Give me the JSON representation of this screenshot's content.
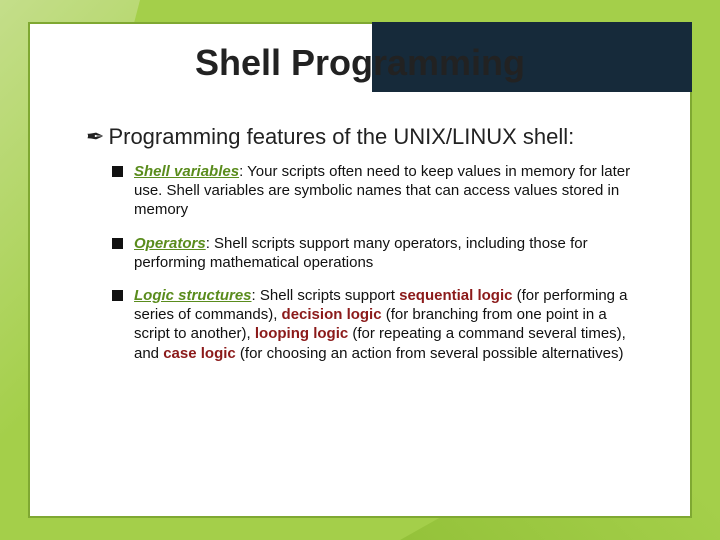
{
  "title": "Shell Programming",
  "intro_bullet": "✒",
  "intro": "Programming features of the UNIX/LINUX shell:",
  "items": [
    {
      "term": "Shell variables",
      "sep": ":  ",
      "rest": "Your scripts often need to keep values in memory for later use.  Shell variables are symbolic names that can access values stored in memory"
    },
    {
      "term": "Operators",
      "sep": ":  ",
      "rest": "Shell scripts support many operators, including those for performing mathematical operations"
    },
    {
      "term": "Logic structures",
      "sep": ":  ",
      "rest_prefix": "Shell scripts support ",
      "e1": "sequential logic",
      "p1": " (for performing a series of commands), ",
      "e2": "decision logic",
      "p2": " (for branching from one point in a script to another), ",
      "e3": "looping logic",
      "p3": " (for repeating a command several times), and ",
      "e4": "case logic",
      "p4": " (for choosing an action from several possible alternatives)"
    }
  ]
}
